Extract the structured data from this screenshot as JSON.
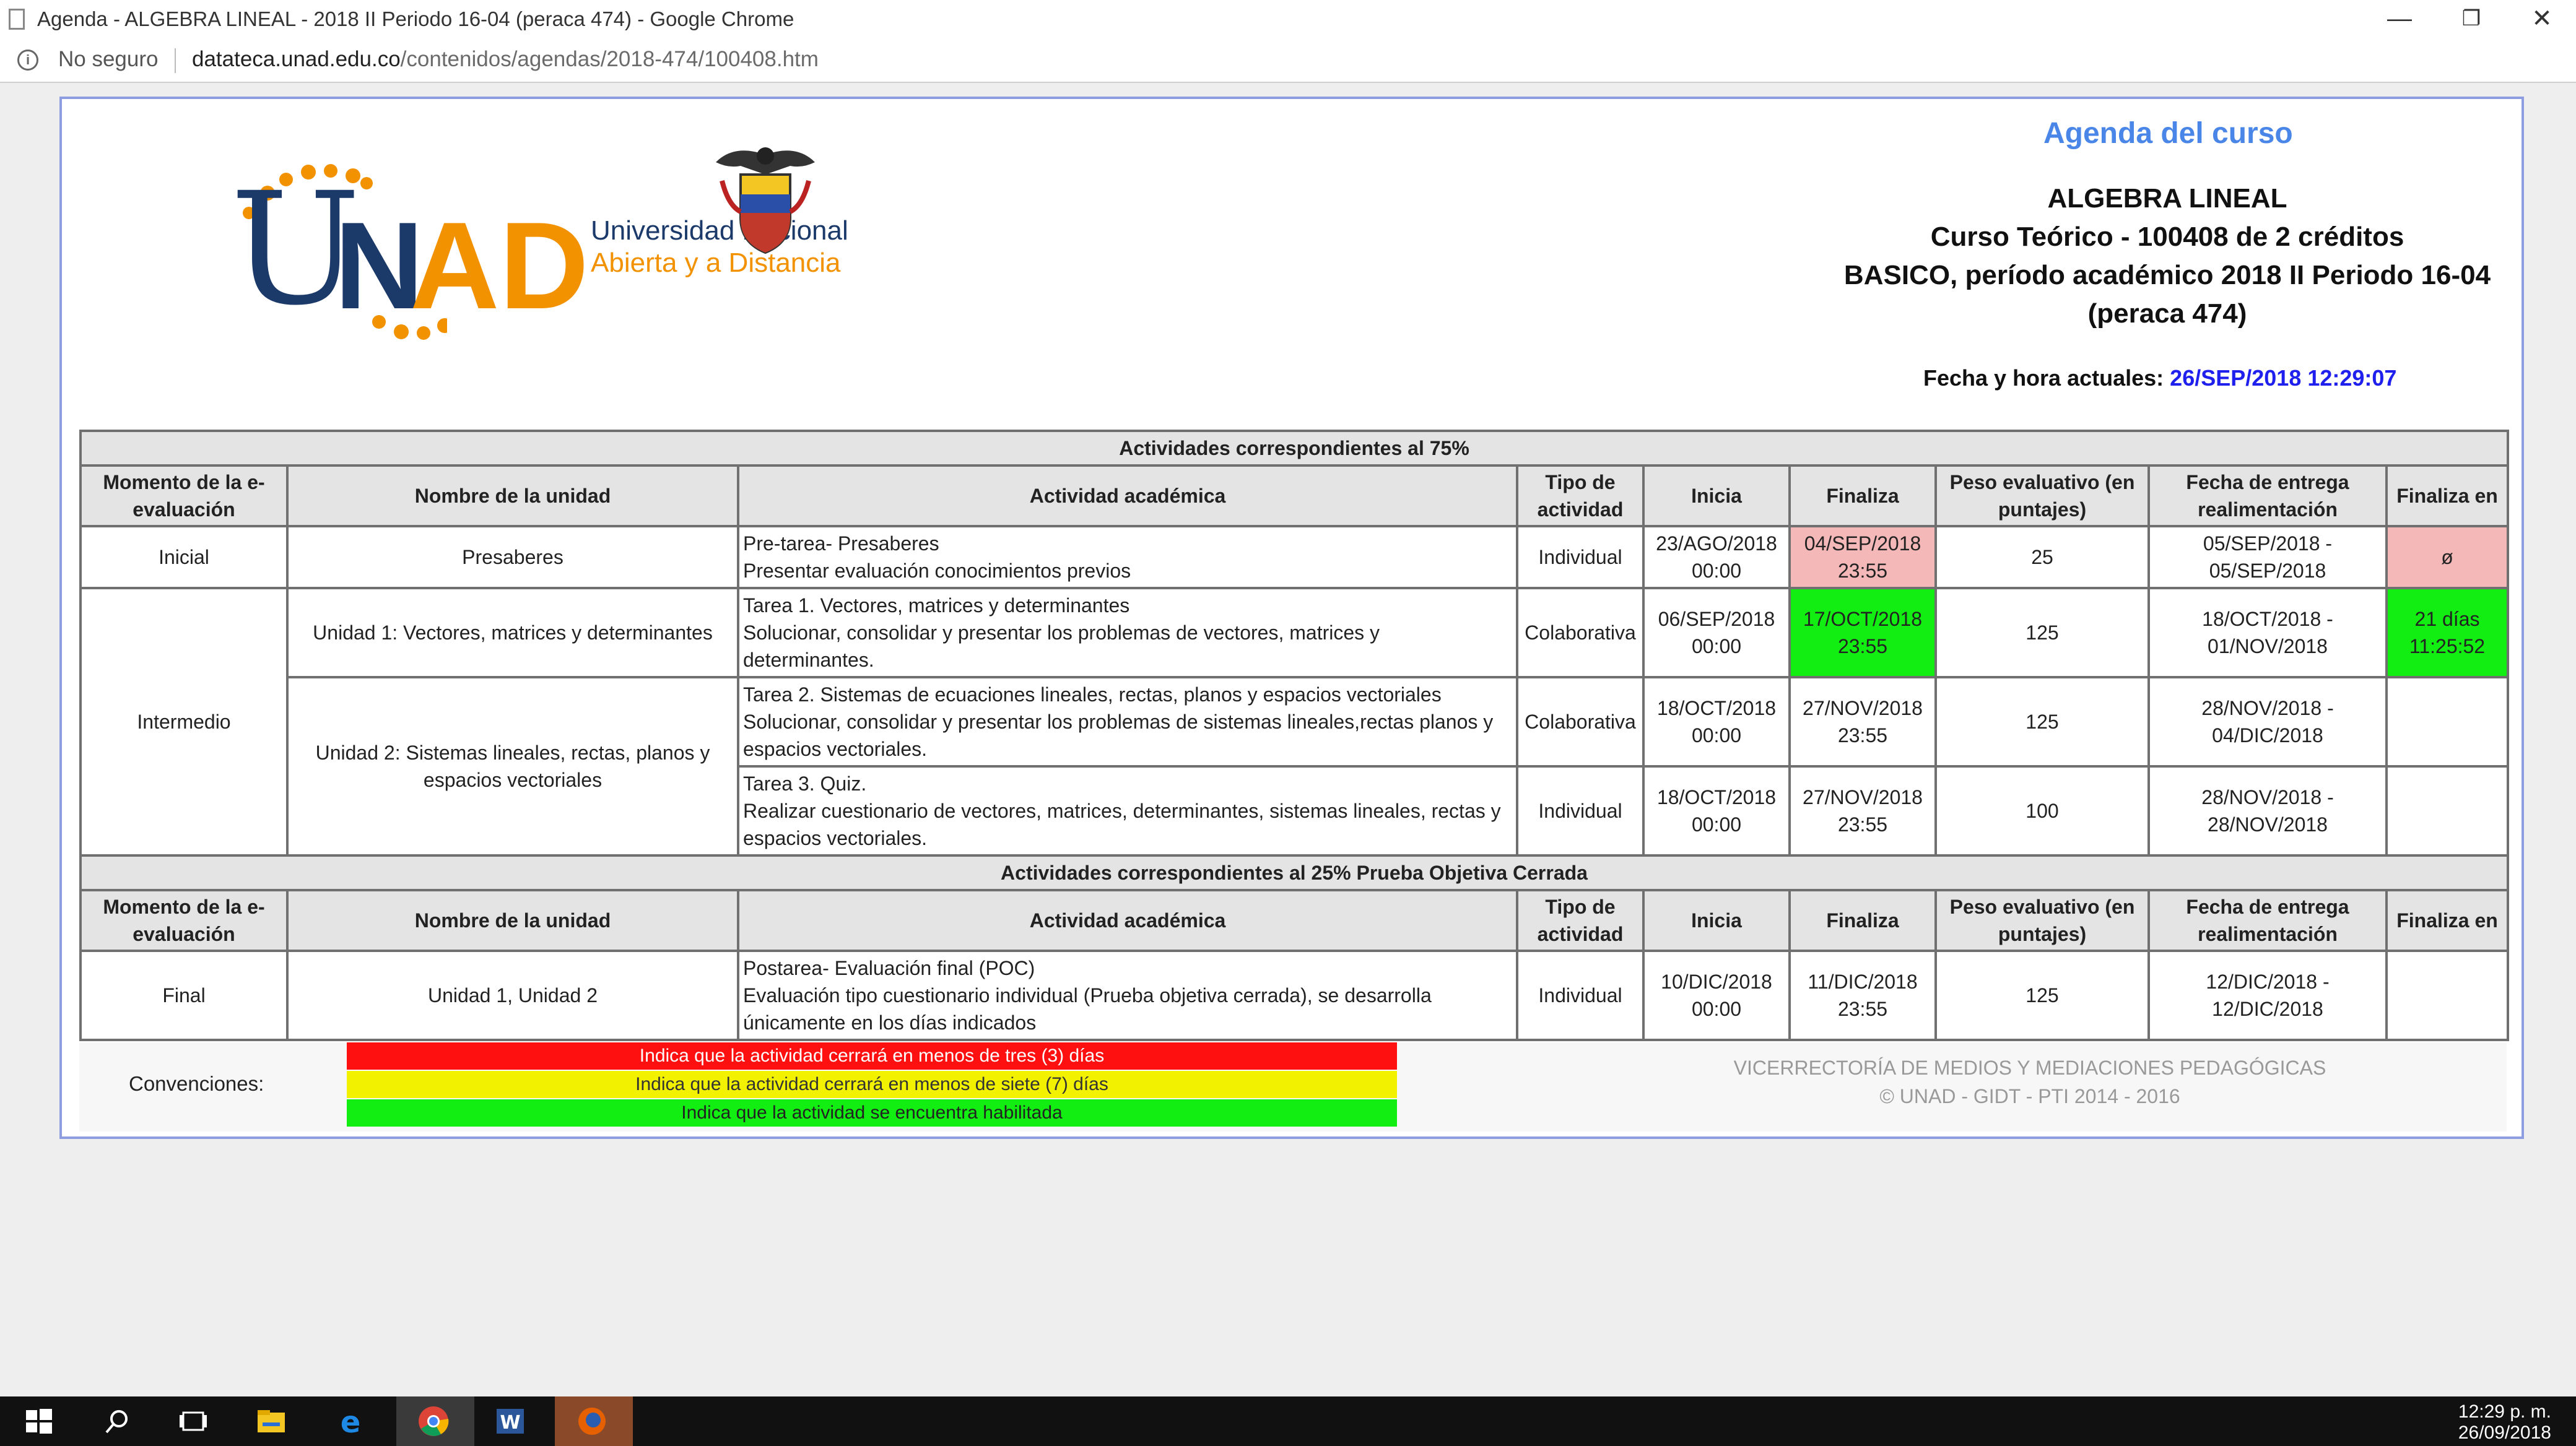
{
  "window": {
    "title": "Agenda - ALGEBRA LINEAL - 2018 II Periodo 16-04 (peraca 474) - Google Chrome",
    "minimize": "—",
    "restore": "❐",
    "close": "✕"
  },
  "address": {
    "security_label": "No seguro",
    "host": "datateca.unad.edu.co",
    "path": "/contenidos/agendas/2018-474/100408.htm"
  },
  "logo": {
    "letter_u": "U",
    "letter_n": "N",
    "letters_ad": "AD",
    "line1": "Universidad Nacional",
    "line2": "Abierta y a  Distancia"
  },
  "header": {
    "agenda_title": "Agenda del curso",
    "course_name": "ALGEBRA LINEAL",
    "course_type": "Curso Teórico - 100408 de 2 créditos",
    "period": "BASICO, período académico 2018 II Periodo 16-04",
    "peraca": "(peraca 474)",
    "date_label": "Fecha y hora actuales: ",
    "date_value": "26/SEP/2018 12:29:07"
  },
  "table": {
    "section1": "Actividades correspondientes al 75%",
    "section2": "Actividades correspondientes al 25% Prueba Objetiva Cerrada",
    "headers": {
      "momento": "Momento de la e-evaluación",
      "unidad": "Nombre de la unidad",
      "actividad": "Actividad académica",
      "tipo": "Tipo de actividad",
      "inicia": "Inicia",
      "finaliza": "Finaliza",
      "peso": "Peso evaluativo (en puntajes)",
      "entrega": "Fecha de entrega realimentación",
      "finaliza_en": "Finaliza en"
    },
    "rows": [
      {
        "momento": "Inicial",
        "unidad": "Presaberes",
        "act_title": "Pre-tarea- Presaberes",
        "act_desc": "Presentar evaluación conocimientos previos",
        "tipo": "Individual",
        "inicia_d": "23/AGO/2018",
        "inicia_t": "00:00",
        "fin_d": "04/SEP/2018",
        "fin_t": "23:55",
        "peso": "25",
        "entrega_a": "05/SEP/2018 -",
        "entrega_b": "05/SEP/2018",
        "finaliza_en": "ø"
      },
      {
        "momento": "Intermedio",
        "unidad": "Unidad 1: Vectores, matrices y determinantes",
        "act_title": "Tarea 1. Vectores, matrices y determinantes",
        "act_desc": "Solucionar, consolidar y presentar los problemas de vectores, matrices y determinantes.",
        "tipo": "Colaborativa",
        "inicia_d": "06/SEP/2018",
        "inicia_t": "00:00",
        "fin_d": "17/OCT/2018",
        "fin_t": "23:55",
        "peso": "125",
        "entrega_a": "18/OCT/2018 -",
        "entrega_b": "01/NOV/2018",
        "finaliza_en_a": "21 días",
        "finaliza_en_b": "11:25:52"
      },
      {
        "unidad": "Unidad 2: Sistemas lineales, rectas, planos y espacios vectoriales",
        "act_title": "Tarea 2. Sistemas de ecuaciones lineales, rectas, planos y espacios vectoriales",
        "act_desc": "Solucionar, consolidar y presentar los problemas de sistemas lineales,rectas planos y espacios vectoriales.",
        "tipo": "Colaborativa",
        "inicia_d": "18/OCT/2018",
        "inicia_t": "00:00",
        "fin_d": "27/NOV/2018",
        "fin_t": "23:55",
        "peso": "125",
        "entrega_a": "28/NOV/2018 -",
        "entrega_b": "04/DIC/2018",
        "finaliza_en": ""
      },
      {
        "act_title": "Tarea 3. Quiz.",
        "act_desc": "Realizar cuestionario de vectores, matrices, determinantes, sistemas lineales, rectas y espacios vectoriales.",
        "tipo": "Individual",
        "inicia_d": "18/OCT/2018",
        "inicia_t": "00:00",
        "fin_d": "27/NOV/2018",
        "fin_t": "23:55",
        "peso": "100",
        "entrega_a": "28/NOV/2018 -",
        "entrega_b": "28/NOV/2018",
        "finaliza_en": ""
      },
      {
        "momento": "Final",
        "unidad": "Unidad 1, Unidad 2",
        "act_title": "Postarea- Evaluación final (POC)",
        "act_desc": "Evaluación tipo cuestionario individual (Prueba objetiva cerrada), se desarrolla únicamente en los días indicados",
        "tipo": "Individual",
        "inicia_d": "10/DIC/2018",
        "inicia_t": "00:00",
        "fin_d": "11/DIC/2018",
        "fin_t": "23:55",
        "peso": "125",
        "entrega_a": "12/DIC/2018 -",
        "entrega_b": "12/DIC/2018",
        "finaliza_en": ""
      }
    ]
  },
  "conventions": {
    "label": "Convenciones:",
    "red": "Indica que la actividad cerrará en menos de tres (3) días",
    "yellow": "Indica que la actividad cerrará en menos de siete (7) días",
    "green": "Indica que la actividad se encuentra habilitada",
    "credit1": "VICERRECTORÍA DE MEDIOS Y MEDIACIONES PEDAGÓGICAS",
    "credit2": "© UNAD - GIDT - PTI 2014 - 2016"
  },
  "colors": {
    "red": "#ff1010",
    "yellow": "#f2f200",
    "green": "#12ee12",
    "pink": "#f4b8b8",
    "agenda_blue": "#4a86e8",
    "unad_blue": "#1b3a6a",
    "unad_orange": "#f39200"
  },
  "taskbar": {
    "time": "12:29 p. m.",
    "date": "26/09/2018",
    "icons": [
      "windows-start-icon",
      "search-icon",
      "task-view-icon",
      "file-explorer-icon",
      "edge-icon",
      "chrome-icon",
      "word-icon",
      "firefox-icon"
    ]
  }
}
